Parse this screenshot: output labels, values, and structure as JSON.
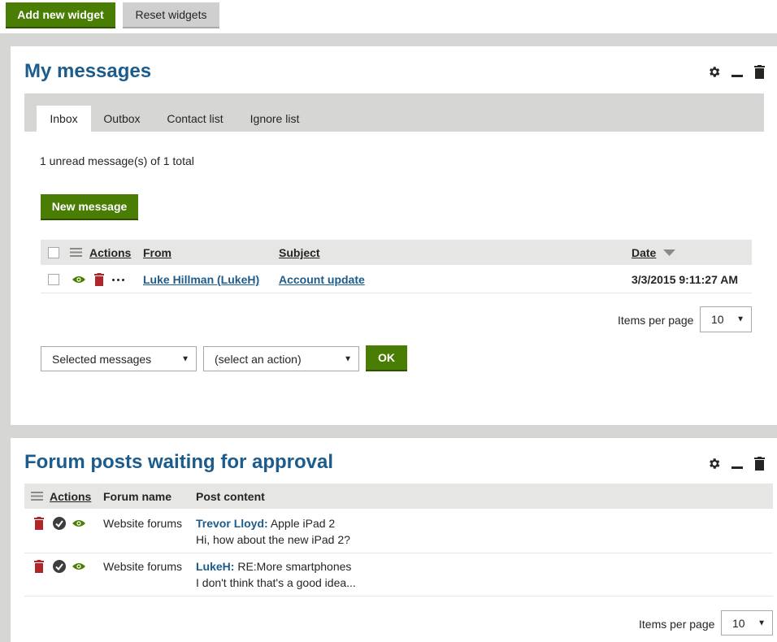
{
  "toolbar": {
    "add_widget": "Add new widget",
    "reset_widgets": "Reset widgets"
  },
  "messages_widget": {
    "title": "My messages",
    "tabs": [
      "Inbox",
      "Outbox",
      "Contact list",
      "Ignore list"
    ],
    "active_tab": "Inbox",
    "unread_summary": "1 unread message(s) of 1 total",
    "new_message": "New message",
    "columns": {
      "actions": "Actions",
      "from": "From",
      "subject": "Subject",
      "date": "Date"
    },
    "rows": [
      {
        "from": "Luke Hillman (LukeH)",
        "subject": "Account update",
        "date": "3/3/2015 9:11:27 AM"
      }
    ],
    "items_per_page_label": "Items per page",
    "items_per_page_value": "10",
    "selection_select": "Selected messages",
    "action_select": "(select an action)",
    "ok": "OK"
  },
  "forum_widget": {
    "title": "Forum posts waiting for approval",
    "columns": {
      "actions": "Actions",
      "forum_name": "Forum name",
      "post_content": "Post content"
    },
    "rows": [
      {
        "forum": "Website forums",
        "author": "Trevor Lloyd:",
        "subject": "Apple iPad 2",
        "text": "Hi, how about the new iPad 2?"
      },
      {
        "forum": "Website forums",
        "author": "LukeH:",
        "subject": "RE:More smartphones",
        "text": "I don't think that's a good idea..."
      }
    ],
    "items_per_page_label": "Items per page",
    "items_per_page_value": "10"
  },
  "colors": {
    "brand_blue": "#1c5c8c",
    "green": "#497d04",
    "delete_red": "#b12628"
  },
  "icons": [
    "gear-icon",
    "minimize-icon",
    "trash-icon",
    "eye-icon",
    "check-circle-icon",
    "more-icon",
    "menu-icon",
    "sort-desc-icon",
    "dropdown-arrow-icon"
  ]
}
